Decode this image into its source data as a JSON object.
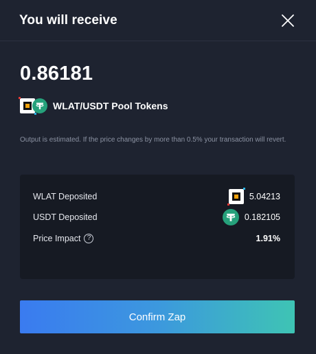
{
  "header": {
    "title": "You will receive"
  },
  "receive": {
    "amount": "0.86181",
    "token_label": "WLAT/USDT Pool Tokens"
  },
  "note": "Output is estimated. If the price changes by more than 0.5% your transaction will revert.",
  "details": {
    "rows": [
      {
        "label": "WLAT Deposited",
        "value": "5.04213",
        "icon": "wlat-token-icon"
      },
      {
        "label": "USDT Deposited",
        "value": "0.182105",
        "icon": "usdt-token-icon"
      },
      {
        "label": "Price Impact",
        "value": "1.91%",
        "icon": "help-icon"
      }
    ],
    "help_glyph": "?"
  },
  "actions": {
    "confirm_label": "Confirm Zap"
  },
  "colors": {
    "background": "#1e2330",
    "panel": "#161a23",
    "usdt": "#26a17b",
    "button_start": "#3a7bf0",
    "button_end": "#3ec4b4"
  }
}
